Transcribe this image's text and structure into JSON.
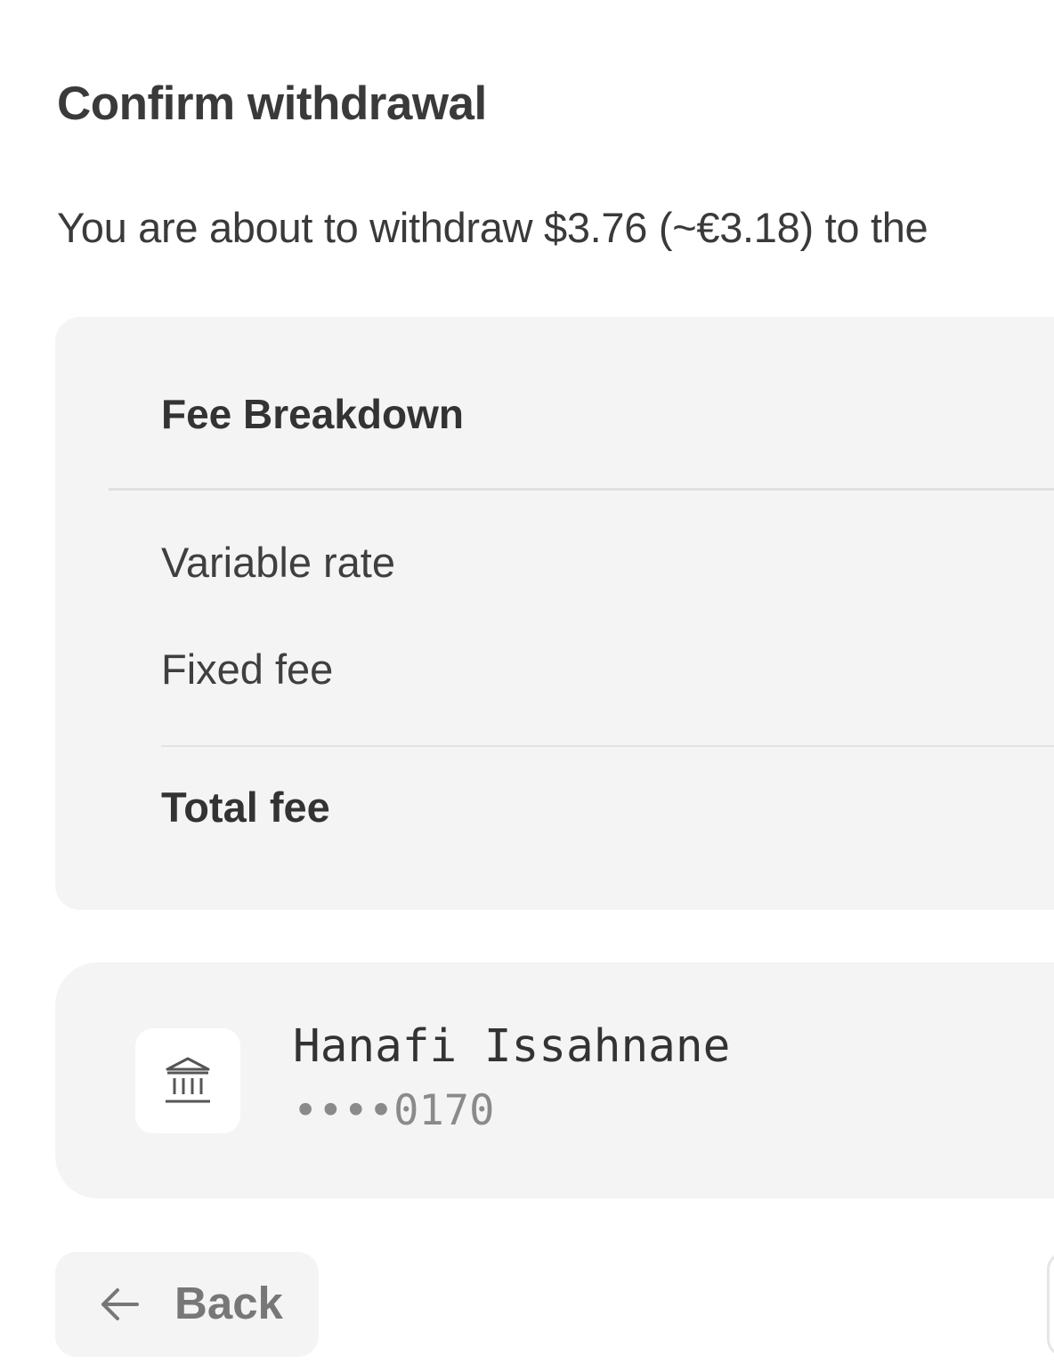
{
  "dialog": {
    "title": "Confirm withdrawal",
    "description": "You are about to withdraw $3.76 (~€3.18) to the"
  },
  "fee_breakdown": {
    "title": "Fee Breakdown",
    "rows": [
      {
        "label": "Variable rate"
      },
      {
        "label": "Fixed fee"
      }
    ],
    "total_label": "Total fee"
  },
  "account": {
    "icon": "bank-icon",
    "name": "Hanafi Issahnane",
    "number_masked": "••••0170"
  },
  "actions": {
    "back_label": "Back",
    "back_icon": "arrow-left-icon"
  }
}
